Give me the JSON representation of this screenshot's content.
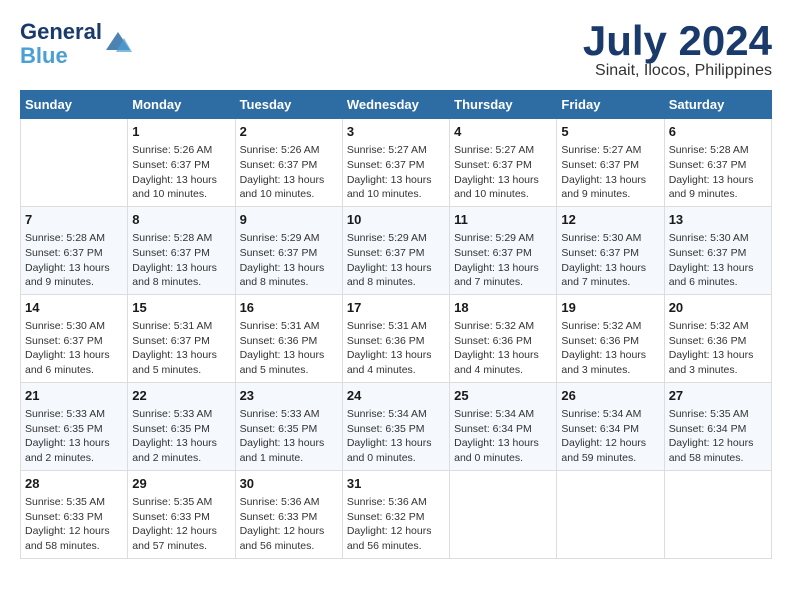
{
  "header": {
    "logo_line1": "General",
    "logo_line2": "Blue",
    "title": "July 2024",
    "subtitle": "Sinait, Ilocos, Philippines"
  },
  "calendar": {
    "days_of_week": [
      "Sunday",
      "Monday",
      "Tuesday",
      "Wednesday",
      "Thursday",
      "Friday",
      "Saturday"
    ],
    "weeks": [
      [
        {
          "day": "",
          "info": ""
        },
        {
          "day": "1",
          "info": "Sunrise: 5:26 AM\nSunset: 6:37 PM\nDaylight: 13 hours\nand 10 minutes."
        },
        {
          "day": "2",
          "info": "Sunrise: 5:26 AM\nSunset: 6:37 PM\nDaylight: 13 hours\nand 10 minutes."
        },
        {
          "day": "3",
          "info": "Sunrise: 5:27 AM\nSunset: 6:37 PM\nDaylight: 13 hours\nand 10 minutes."
        },
        {
          "day": "4",
          "info": "Sunrise: 5:27 AM\nSunset: 6:37 PM\nDaylight: 13 hours\nand 10 minutes."
        },
        {
          "day": "5",
          "info": "Sunrise: 5:27 AM\nSunset: 6:37 PM\nDaylight: 13 hours\nand 9 minutes."
        },
        {
          "day": "6",
          "info": "Sunrise: 5:28 AM\nSunset: 6:37 PM\nDaylight: 13 hours\nand 9 minutes."
        }
      ],
      [
        {
          "day": "7",
          "info": "Sunrise: 5:28 AM\nSunset: 6:37 PM\nDaylight: 13 hours\nand 9 minutes."
        },
        {
          "day": "8",
          "info": "Sunrise: 5:28 AM\nSunset: 6:37 PM\nDaylight: 13 hours\nand 8 minutes."
        },
        {
          "day": "9",
          "info": "Sunrise: 5:29 AM\nSunset: 6:37 PM\nDaylight: 13 hours\nand 8 minutes."
        },
        {
          "day": "10",
          "info": "Sunrise: 5:29 AM\nSunset: 6:37 PM\nDaylight: 13 hours\nand 8 minutes."
        },
        {
          "day": "11",
          "info": "Sunrise: 5:29 AM\nSunset: 6:37 PM\nDaylight: 13 hours\nand 7 minutes."
        },
        {
          "day": "12",
          "info": "Sunrise: 5:30 AM\nSunset: 6:37 PM\nDaylight: 13 hours\nand 7 minutes."
        },
        {
          "day": "13",
          "info": "Sunrise: 5:30 AM\nSunset: 6:37 PM\nDaylight: 13 hours\nand 6 minutes."
        }
      ],
      [
        {
          "day": "14",
          "info": "Sunrise: 5:30 AM\nSunset: 6:37 PM\nDaylight: 13 hours\nand 6 minutes."
        },
        {
          "day": "15",
          "info": "Sunrise: 5:31 AM\nSunset: 6:37 PM\nDaylight: 13 hours\nand 5 minutes."
        },
        {
          "day": "16",
          "info": "Sunrise: 5:31 AM\nSunset: 6:36 PM\nDaylight: 13 hours\nand 5 minutes."
        },
        {
          "day": "17",
          "info": "Sunrise: 5:31 AM\nSunset: 6:36 PM\nDaylight: 13 hours\nand 4 minutes."
        },
        {
          "day": "18",
          "info": "Sunrise: 5:32 AM\nSunset: 6:36 PM\nDaylight: 13 hours\nand 4 minutes."
        },
        {
          "day": "19",
          "info": "Sunrise: 5:32 AM\nSunset: 6:36 PM\nDaylight: 13 hours\nand 3 minutes."
        },
        {
          "day": "20",
          "info": "Sunrise: 5:32 AM\nSunset: 6:36 PM\nDaylight: 13 hours\nand 3 minutes."
        }
      ],
      [
        {
          "day": "21",
          "info": "Sunrise: 5:33 AM\nSunset: 6:35 PM\nDaylight: 13 hours\nand 2 minutes."
        },
        {
          "day": "22",
          "info": "Sunrise: 5:33 AM\nSunset: 6:35 PM\nDaylight: 13 hours\nand 2 minutes."
        },
        {
          "day": "23",
          "info": "Sunrise: 5:33 AM\nSunset: 6:35 PM\nDaylight: 13 hours\nand 1 minute."
        },
        {
          "day": "24",
          "info": "Sunrise: 5:34 AM\nSunset: 6:35 PM\nDaylight: 13 hours\nand 0 minutes."
        },
        {
          "day": "25",
          "info": "Sunrise: 5:34 AM\nSunset: 6:34 PM\nDaylight: 13 hours\nand 0 minutes."
        },
        {
          "day": "26",
          "info": "Sunrise: 5:34 AM\nSunset: 6:34 PM\nDaylight: 12 hours\nand 59 minutes."
        },
        {
          "day": "27",
          "info": "Sunrise: 5:35 AM\nSunset: 6:34 PM\nDaylight: 12 hours\nand 58 minutes."
        }
      ],
      [
        {
          "day": "28",
          "info": "Sunrise: 5:35 AM\nSunset: 6:33 PM\nDaylight: 12 hours\nand 58 minutes."
        },
        {
          "day": "29",
          "info": "Sunrise: 5:35 AM\nSunset: 6:33 PM\nDaylight: 12 hours\nand 57 minutes."
        },
        {
          "day": "30",
          "info": "Sunrise: 5:36 AM\nSunset: 6:33 PM\nDaylight: 12 hours\nand 56 minutes."
        },
        {
          "day": "31",
          "info": "Sunrise: 5:36 AM\nSunset: 6:32 PM\nDaylight: 12 hours\nand 56 minutes."
        },
        {
          "day": "",
          "info": ""
        },
        {
          "day": "",
          "info": ""
        },
        {
          "day": "",
          "info": ""
        }
      ]
    ]
  }
}
